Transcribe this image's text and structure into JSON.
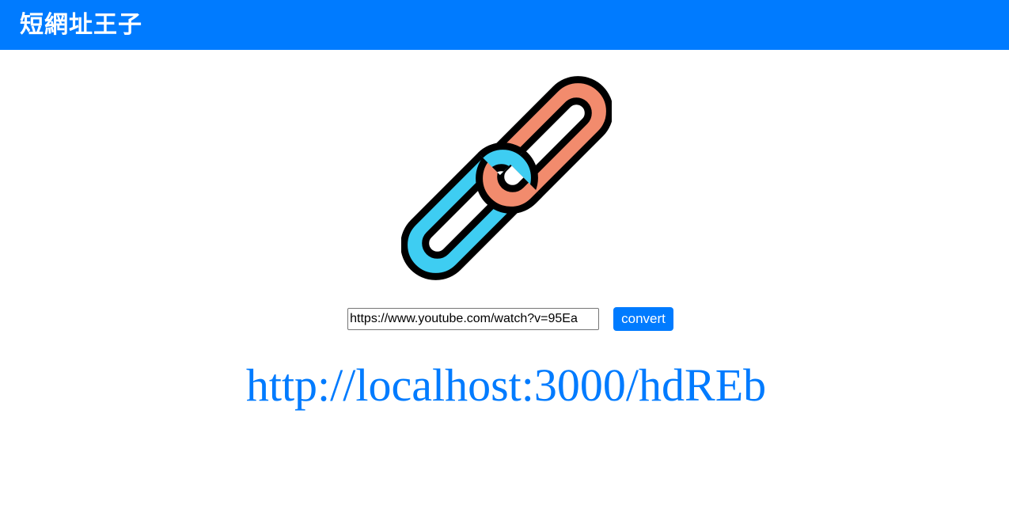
{
  "header": {
    "brand_title": "短網址王子"
  },
  "logo": {
    "icon": "chain-link-icon",
    "colors": {
      "link_a": "#f28b6d",
      "link_b": "#3ecdf2",
      "outline": "#000000"
    }
  },
  "form": {
    "url_value": "https://www.youtube.com/watch?v=95Ea",
    "convert_label": "convert"
  },
  "result": {
    "short_url": "http://localhost:3000/hdREb"
  },
  "theme": {
    "accent": "#007bff",
    "background": "#ffffff"
  }
}
